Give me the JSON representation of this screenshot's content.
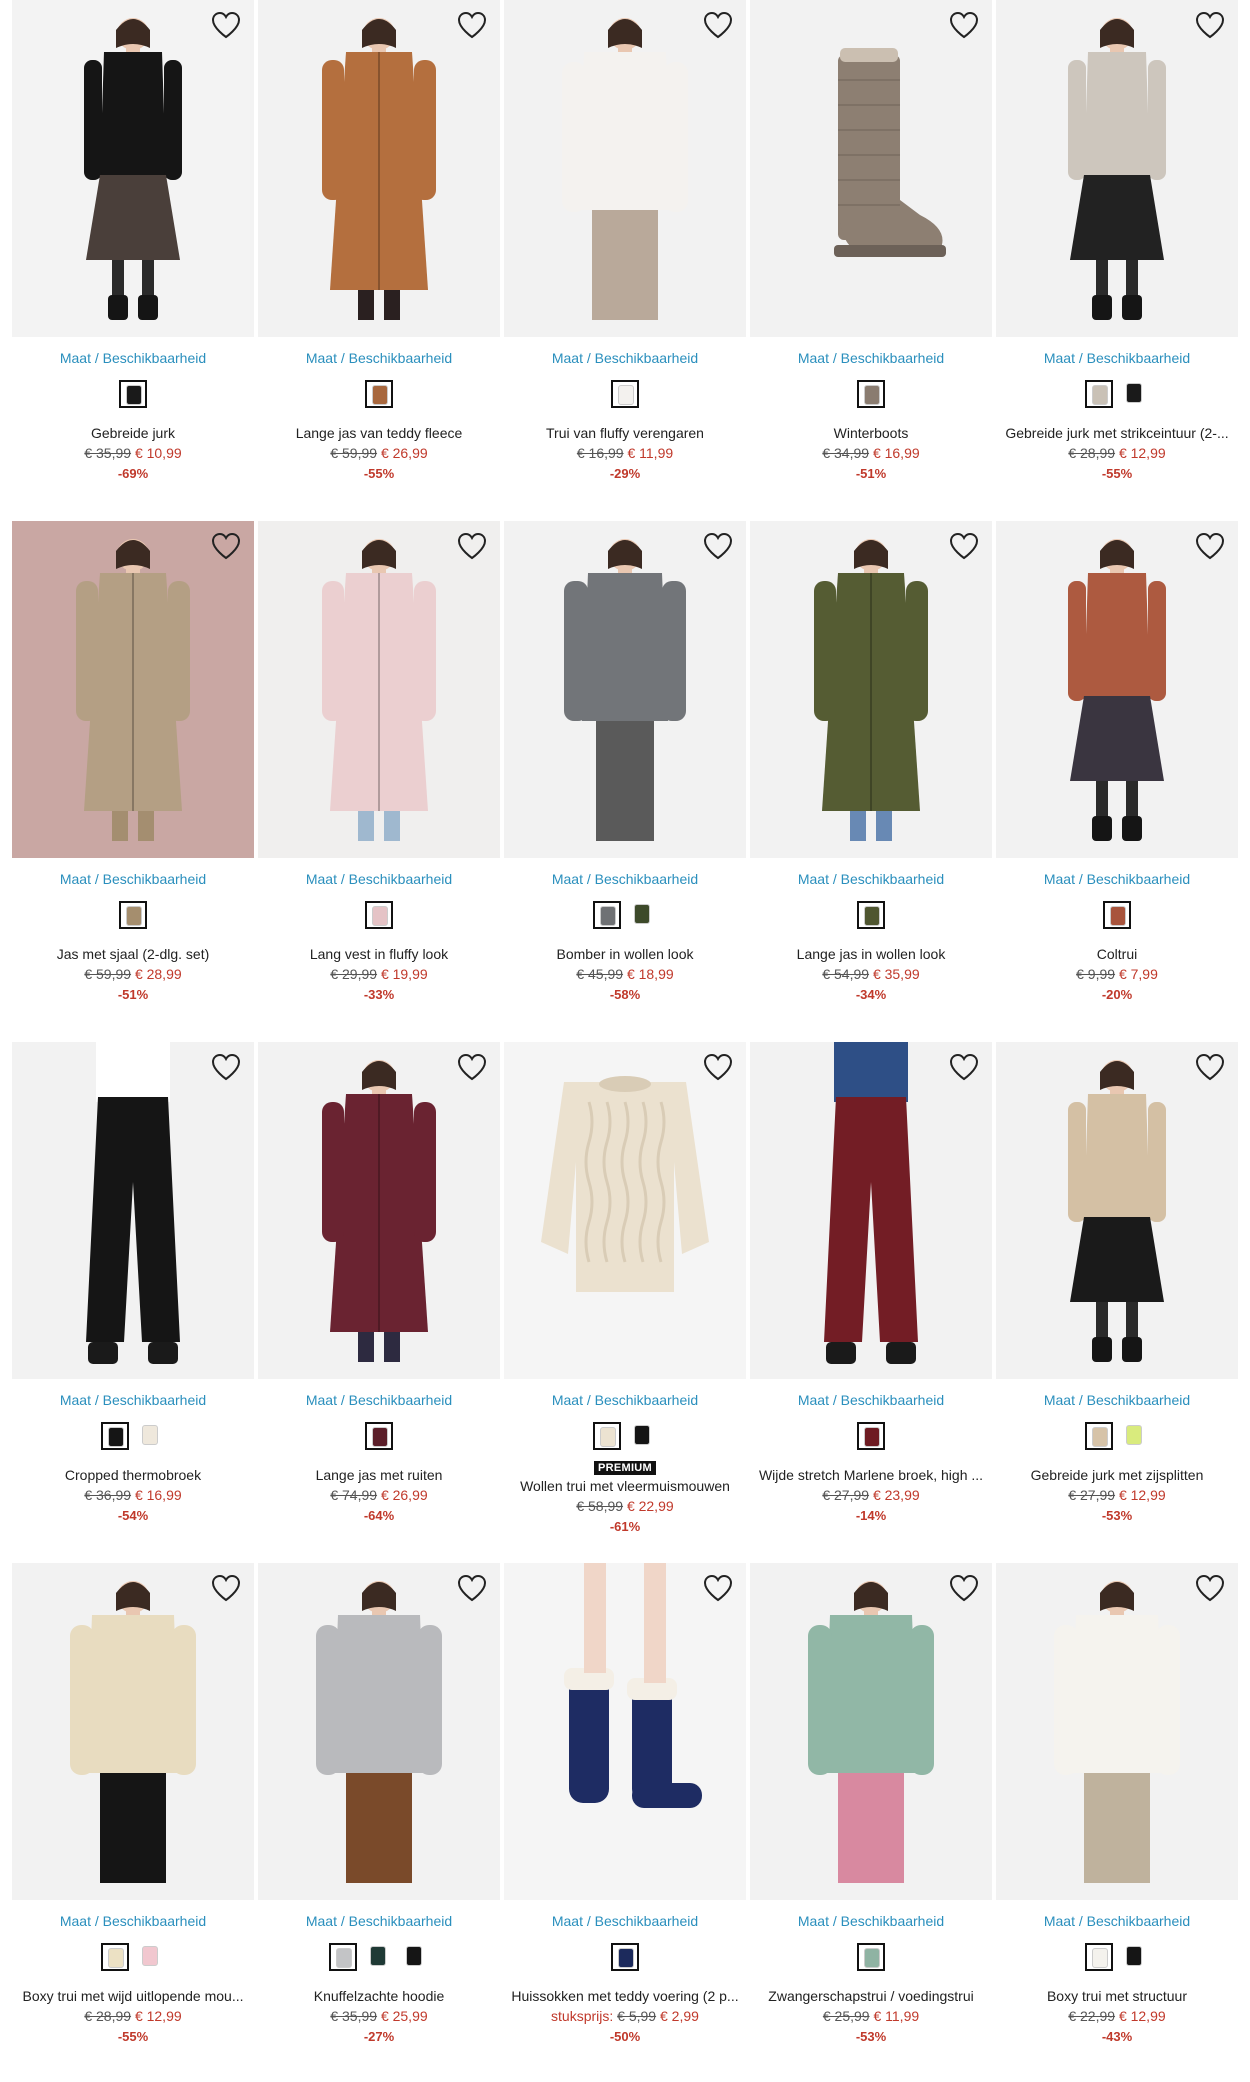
{
  "size_link": {
    "part1": "Maat",
    "sep": " / ",
    "part2": "Beschikbaarheid"
  },
  "colors": {
    "link": "#2a8fbd",
    "sale": "#c0392b",
    "strike": "#555555",
    "selected_border": "#111111"
  },
  "products": [
    {
      "name": "Gebreide jurk",
      "old": "€ 35,99",
      "new": "€ 10,99",
      "disc": "-69%",
      "swatches": [
        "#1a1a1a"
      ],
      "bg": "#f3f3f3",
      "main": "#151515",
      "accent": "#4a3f3a",
      "type": "dress"
    },
    {
      "name": "Lange jas van teddy fleece",
      "old": "€ 59,99",
      "new": "€ 26,99",
      "disc": "-55%",
      "swatches": [
        "#a8683e"
      ],
      "bg": "#f2f2f2",
      "main": "#b46f3e",
      "accent": "#2a2020",
      "type": "coat"
    },
    {
      "name": "Trui van fluffy verengaren",
      "old": "€ 16,99",
      "new": "€ 11,99",
      "disc": "-29%",
      "swatches": [
        "#f3f1ee"
      ],
      "bg": "#f2f2f2",
      "main": "#f4f2ef",
      "accent": "#b9a99a",
      "type": "sweater"
    },
    {
      "name": "Winterboots",
      "old": "€ 34,99",
      "new": "€ 16,99",
      "disc": "-51%",
      "swatches": [
        "#8a7c70"
      ],
      "bg": "#f2f2f2",
      "main": "#8d7f72",
      "accent": "#6c6158",
      "type": "boot"
    },
    {
      "name": "Gebreide jurk met strikceintuur (2-...",
      "old": "€ 28,99",
      "new": "€ 12,99",
      "disc": "-55%",
      "swatches": [
        "#c9c1b6",
        "#1a1a1a"
      ],
      "bg": "#f2f2f2",
      "main": "#cdc6bd",
      "accent": "#222222",
      "type": "dress"
    },
    {
      "name": "Jas met sjaal (2-dlg. set)",
      "old": "€ 59,99",
      "new": "€ 28,99",
      "disc": "-51%",
      "swatches": [
        "#a58e6e"
      ],
      "bg": "#c9a7a3",
      "main": "#b49f84",
      "accent": "#a48e70",
      "type": "coat"
    },
    {
      "name": "Lang vest in fluffy look",
      "old": "€ 29,99",
      "new": "€ 19,99",
      "disc": "-33%",
      "swatches": [
        "#e5c3c6"
      ],
      "bg": "#f0efee",
      "main": "#ebcfd0",
      "accent": "#9fb8cf",
      "type": "cardigan"
    },
    {
      "name": "Bomber in wollen look",
      "old": "€ 45,99",
      "new": "€ 18,99",
      "disc": "-58%",
      "swatches": [
        "#6f7174",
        "#3d4a2a"
      ],
      "bg": "#f2f2f2",
      "main": "#727579",
      "accent": "#5a5a5a",
      "type": "jacket"
    },
    {
      "name": "Lange jas in wollen look",
      "old": "€ 54,99",
      "new": "€ 35,99",
      "disc": "-34%",
      "swatches": [
        "#4f5630"
      ],
      "bg": "#f2f2f2",
      "main": "#555c33",
      "accent": "#6889b4",
      "type": "coat"
    },
    {
      "name": "Coltrui",
      "old": "€ 9,99",
      "new": "€ 7,99",
      "disc": "-20%",
      "swatches": [
        "#a8543c"
      ],
      "bg": "#f2f2f2",
      "main": "#ad5a40",
      "accent": "#3a3540",
      "type": "dress"
    },
    {
      "name": "Cropped thermobroek",
      "old": "€ 36,99",
      "new": "€ 16,99",
      "disc": "-54%",
      "swatches": [
        "#151515",
        "#efe8dc"
      ],
      "bg": "#f2f2f2",
      "main": "#151515",
      "accent": "#ffffff",
      "type": "pants"
    },
    {
      "name": "Lange jas met ruiten",
      "old": "€ 74,99",
      "new": "€ 26,99",
      "disc": "-64%",
      "swatches": [
        "#5c1f2a"
      ],
      "bg": "#f2f2f2",
      "main": "#6a2331",
      "accent": "#2d2a40",
      "type": "coat"
    },
    {
      "name": "Wollen trui met vleermuismouwen",
      "old": "€ 58,99",
      "new": "€ 22,99",
      "disc": "-61%",
      "swatches": [
        "#ece3d1",
        "#151515"
      ],
      "bg": "#f5f5f5",
      "main": "#ebe1cf",
      "accent": "#d9ccb6",
      "type": "knit",
      "premium": "PREMIUM"
    },
    {
      "name": "Wijde stretch Marlene broek, high ...",
      "old": "€ 27,99",
      "new": "€ 23,99",
      "disc": "-14%",
      "swatches": [
        "#6e1b22"
      ],
      "bg": "#f2f2f2",
      "main": "#731d25",
      "accent": "#2e4f86",
      "type": "pants"
    },
    {
      "name": "Gebreide jurk met zijsplitten",
      "old": "€ 27,99",
      "new": "€ 12,99",
      "disc": "-53%",
      "swatches": [
        "#d6c3a8",
        "#d9eb7d"
      ],
      "bg": "#f2f2f2",
      "main": "#d4c0a4",
      "accent": "#1a1a1a",
      "type": "dress"
    },
    {
      "name": "Boxy trui met wijd uitlopende mou...",
      "old": "€ 28,99",
      "new": "€ 12,99",
      "disc": "-55%",
      "swatches": [
        "#ece1c4",
        "#f1c7cf"
      ],
      "bg": "#f2f2f2",
      "main": "#e8dcc0",
      "accent": "#151515",
      "type": "sweater"
    },
    {
      "name": "Knuffelzachte hoodie",
      "old": "€ 35,99",
      "new": "€ 25,99",
      "disc": "-27%",
      "swatches": [
        "#c3c4c6",
        "#1f3a35",
        "#151515"
      ],
      "bg": "#f2f2f2",
      "main": "#b9babd",
      "accent": "#7a4a2a",
      "type": "sweater"
    },
    {
      "name": "Huissokken met teddy voering (2 p...",
      "old": "€ 5,99",
      "new": "€ 2,99",
      "disc": "-50%",
      "prefix": "stuksprijs:",
      "swatches": [
        "#1c2a5c"
      ],
      "bg": "#f5f5f5",
      "main": "#1e2c63",
      "accent": "#f4efe6",
      "type": "socks"
    },
    {
      "name": "Zwangerschapstrui / voedingstrui",
      "old": "€ 25,99",
      "new": "€ 11,99",
      "disc": "-53%",
      "swatches": [
        "#8fb3a3"
      ],
      "bg": "#f2f2f2",
      "main": "#91b7a6",
      "accent": "#d889a0",
      "type": "sweater"
    },
    {
      "name": "Boxy trui met structuur",
      "old": "€ 22,99",
      "new": "€ 12,99",
      "disc": "-43%",
      "swatches": [
        "#f4f2ed",
        "#151515"
      ],
      "bg": "#f2f2f2",
      "main": "#f5f3ee",
      "accent": "#bfb29d",
      "type": "sweater"
    }
  ]
}
